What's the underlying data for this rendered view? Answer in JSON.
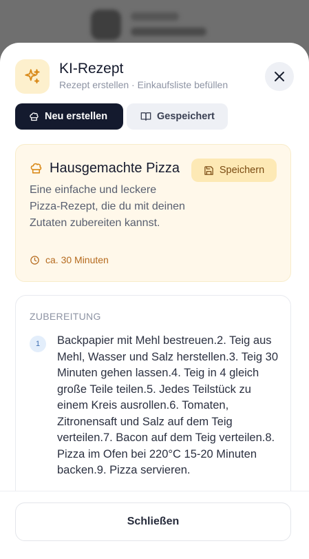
{
  "header": {
    "title": "KI-Rezept",
    "subtitle": "Rezept erstellen · Einkaufsliste befüllen"
  },
  "tabs": [
    {
      "label": "Neu erstellen",
      "icon": "chef-hat-icon",
      "active": true
    },
    {
      "label": "Gespeichert",
      "icon": "book-open-icon",
      "active": false
    }
  ],
  "recipe": {
    "title": "Hausgemachte Pizza",
    "save_label": "Speichern",
    "description": "Eine einfache und leckere Pizza-Rezept, die du mit deinen Zutaten zubereiten kannst.",
    "time": "ca. 30 Minuten"
  },
  "steps": {
    "heading": "ZUBEREITUNG",
    "items": [
      {
        "number": "1",
        "text": "Backpapier mit Mehl bestreuen.2. Teig aus Mehl, Wasser und Salz herstellen.3. Teig 30 Minuten gehen lassen.4. Teig in 4 gleich große Teile teilen.5. Jedes Teilstück zu einem Kreis ausrollen.6. Tomaten, Zitronensaft und Salz auf dem Teig verteilen.7. Bacon auf dem Teig verteilen.8. Pizza im Ofen bei 220°C 15-20 Minuten backen.9. Pizza servieren."
      }
    ]
  },
  "footer": {
    "close_label": "Schließen"
  },
  "colors": {
    "accent_dark": "#141a2e",
    "warm_bg": "#fff8ea",
    "save_bg": "#fde9b5",
    "time_color": "#b56a1e"
  }
}
